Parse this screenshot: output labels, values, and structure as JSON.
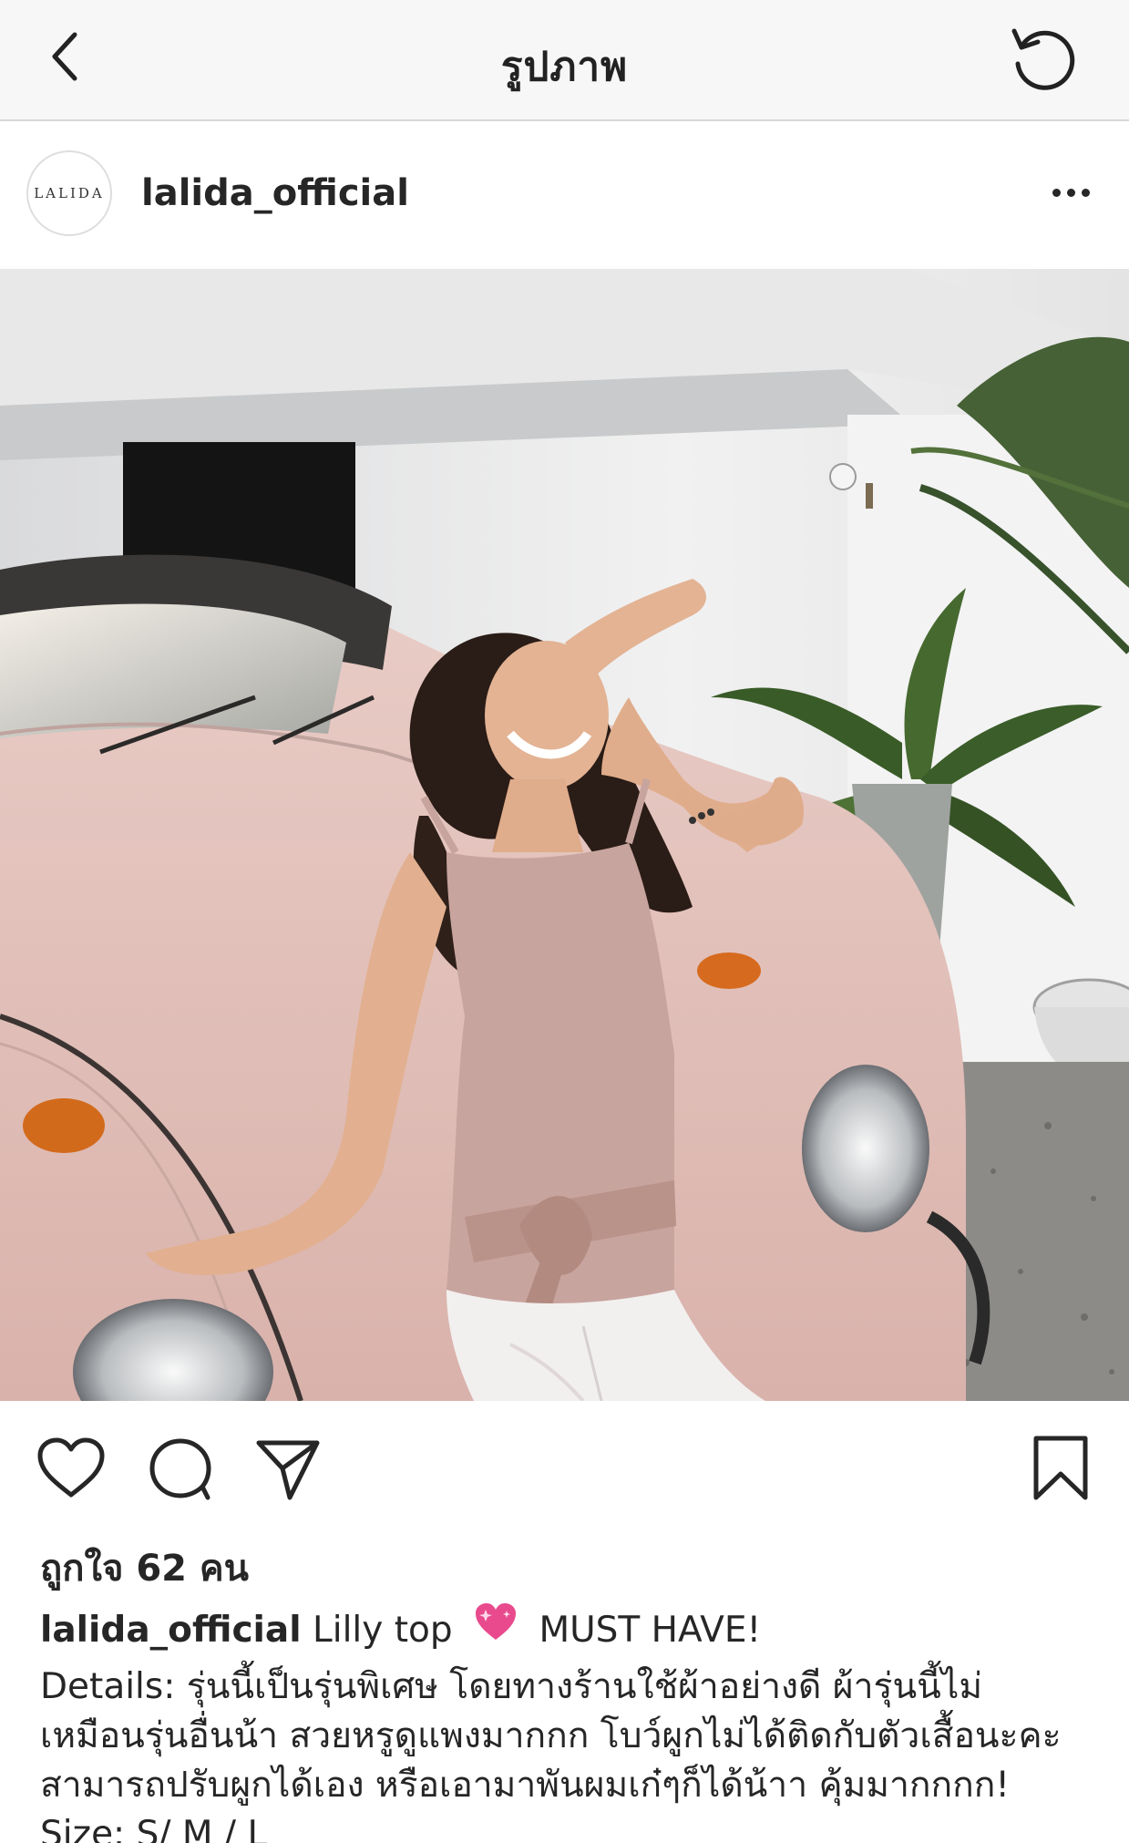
{
  "nav": {
    "title": "รูปภาพ",
    "back_icon": "chevron-left-icon",
    "refresh_icon": "refresh-icon"
  },
  "post": {
    "username": "lalida_official",
    "avatar_text": "LALIDA",
    "likes_text": "ถูกใจ 62 คน",
    "caption": {
      "username": "lalida_official",
      "title_before_emoji": "Lilly top",
      "title_after_emoji": "MUST HAVE!",
      "line1": "Details: รุ่นนี้เป็นรุ่นพิเศษ โดยทางร้านใช้ผ้าอย่างดี ผ้ารุ่นนี้ไม่",
      "line2": "เหมือนรุ่นอื่นน้า สวยหรูดูแพงมากกก โบว์ผูกไม่ได้ติดกับตัวเสื้อนะคะ",
      "line3": "สามารถปรับผูกได้เอง หรือเอามาพันผมเก๋ๆก็ได้น้าา คุ้มมากกกก!",
      "line4": "Size: S/ M / L"
    }
  },
  "icons": {
    "like": "heart-icon",
    "comment": "comment-icon",
    "share": "paper-plane-icon",
    "save": "bookmark-icon",
    "more": "more-icon",
    "emoji": "sparkling-heart-icon"
  },
  "colors": {
    "text": "#262626",
    "emoji_pink": "#e84a8d",
    "topbar_bg": "#f7f7f7"
  }
}
